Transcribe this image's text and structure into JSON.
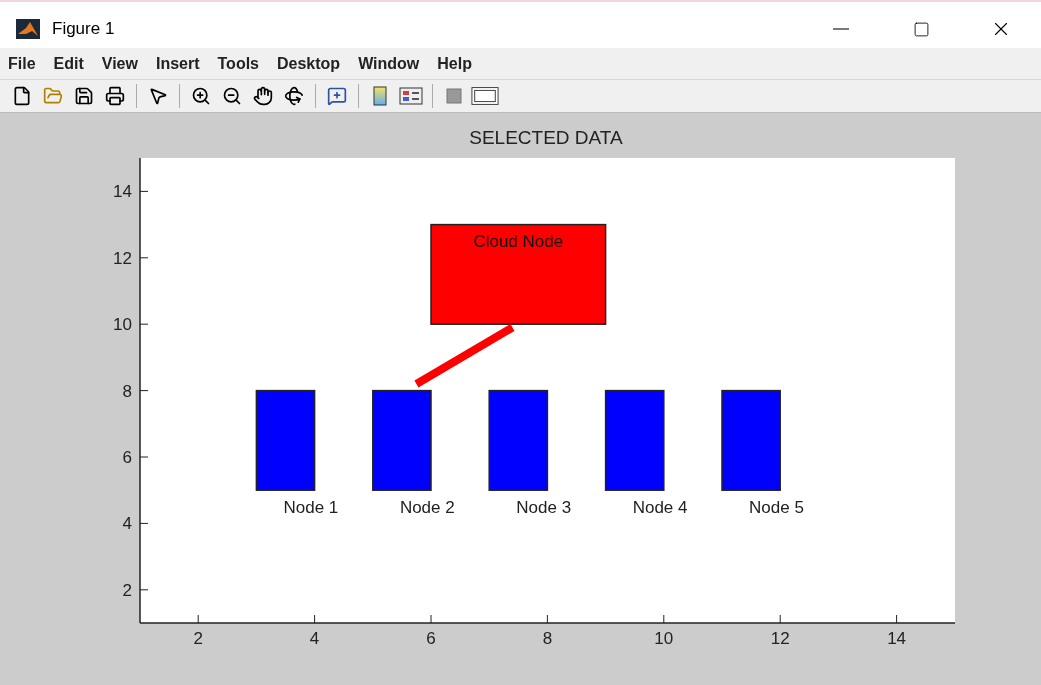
{
  "window": {
    "title": "Figure 1"
  },
  "menu": [
    "File",
    "Edit",
    "View",
    "Insert",
    "Tools",
    "Desktop",
    "Window",
    "Help"
  ],
  "plot": {
    "title": "SELECTED DATA",
    "xticks": [
      "2",
      "4",
      "6",
      "8",
      "10",
      "12",
      "14"
    ],
    "yticks": [
      "14",
      "12",
      "10",
      "8",
      "6",
      "4",
      "2"
    ],
    "cloud_node": {
      "label": "Cloud Node"
    },
    "nodes": [
      {
        "label": "Node 1"
      },
      {
        "label": "Node 2"
      },
      {
        "label": "Node 3"
      },
      {
        "label": "Node 4"
      },
      {
        "label": "Node 5"
      }
    ]
  }
}
